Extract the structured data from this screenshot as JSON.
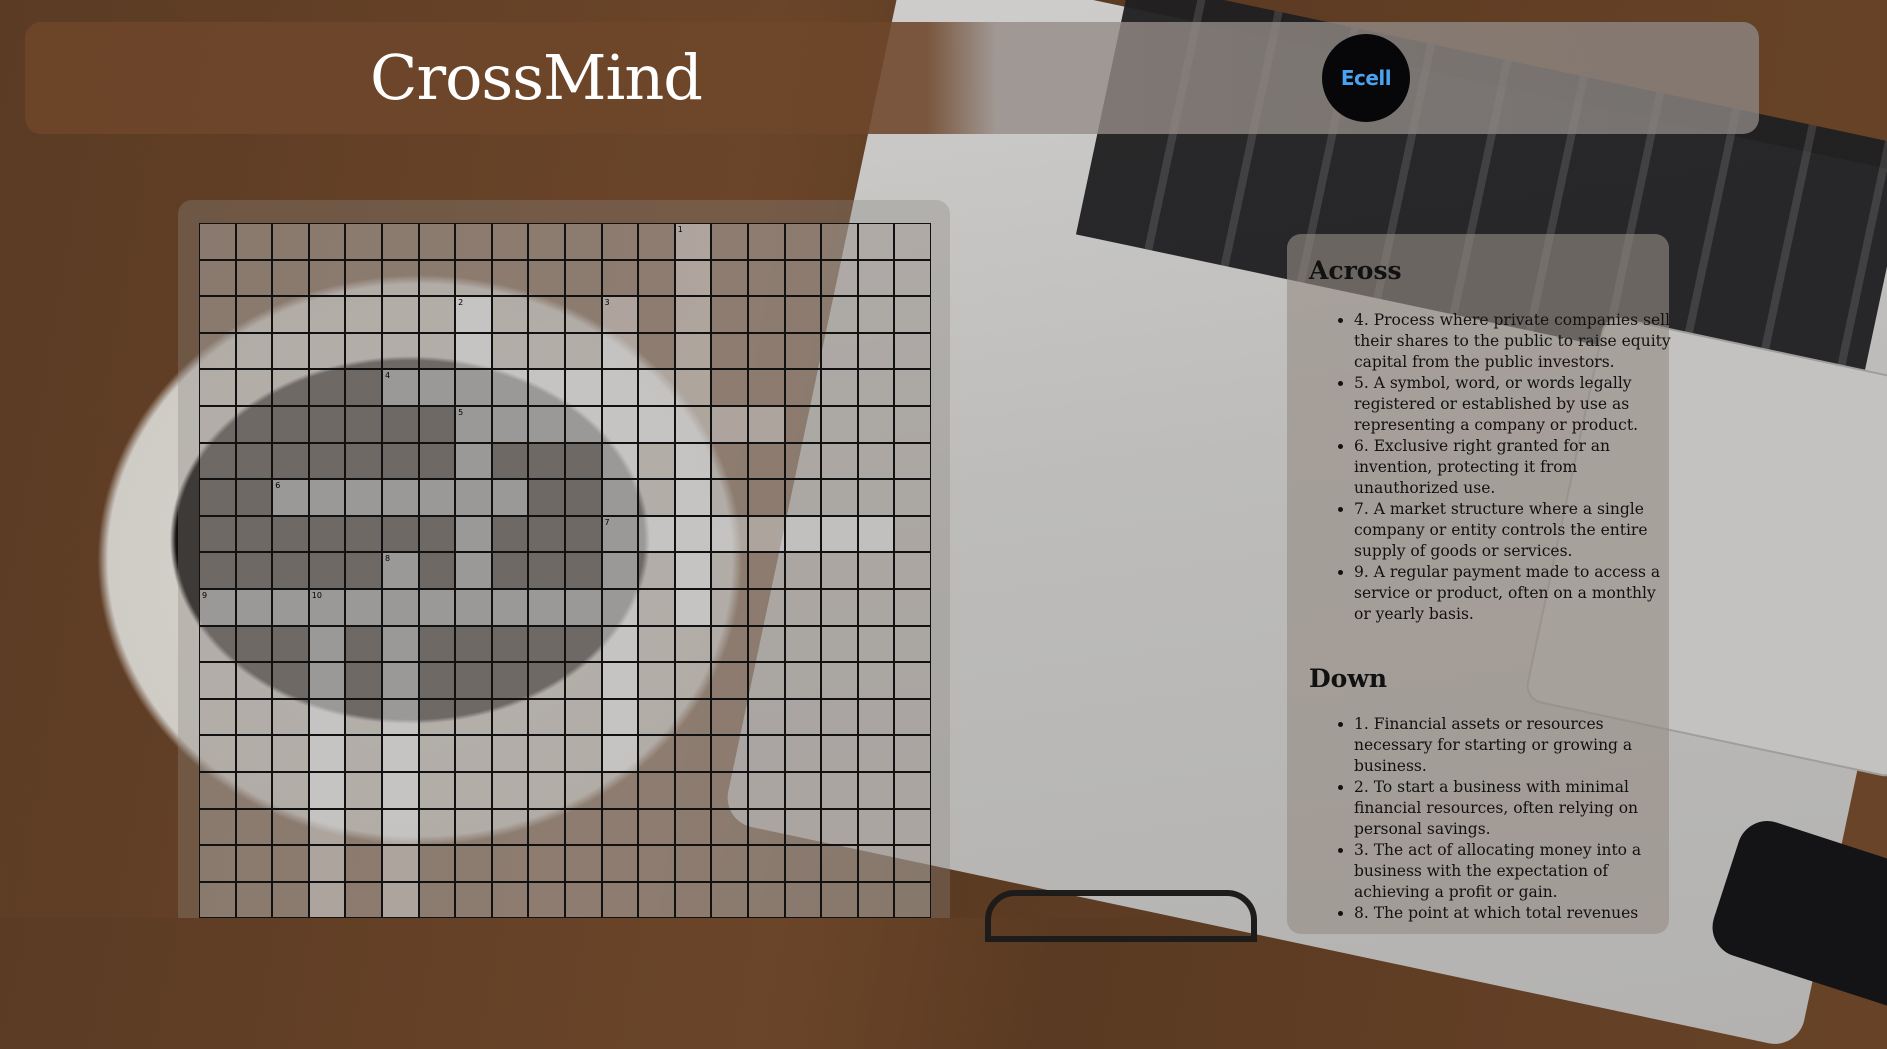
{
  "header": {
    "title": "CrossMind",
    "logo_text": "Ecell"
  },
  "grid": {
    "size": 20,
    "numbers": [
      {
        "n": "1",
        "r": 0,
        "c": 13
      },
      {
        "n": "2",
        "r": 2,
        "c": 7
      },
      {
        "n": "3",
        "r": 2,
        "c": 11
      },
      {
        "n": "4",
        "r": 4,
        "c": 5
      },
      {
        "n": "5",
        "r": 5,
        "c": 7
      },
      {
        "n": "6",
        "r": 7,
        "c": 2
      },
      {
        "n": "7",
        "r": 8,
        "c": 11
      },
      {
        "n": "8",
        "r": 9,
        "c": 5
      },
      {
        "n": "9",
        "r": 10,
        "c": 0
      },
      {
        "n": "10",
        "r": 10,
        "c": 3
      }
    ],
    "light_cells": [
      [
        0,
        13
      ],
      [
        1,
        13
      ],
      [
        2,
        13
      ],
      [
        3,
        13
      ],
      [
        4,
        13
      ],
      [
        5,
        13
      ],
      [
        6,
        13
      ],
      [
        7,
        13
      ],
      [
        8,
        13
      ],
      [
        9,
        13
      ],
      [
        10,
        13
      ],
      [
        2,
        7
      ],
      [
        3,
        7
      ],
      [
        4,
        7
      ],
      [
        5,
        7
      ],
      [
        6,
        7
      ],
      [
        7,
        7
      ],
      [
        8,
        7
      ],
      [
        9,
        7
      ],
      [
        10,
        7
      ],
      [
        2,
        11
      ],
      [
        3,
        11
      ],
      [
        4,
        11
      ],
      [
        5,
        11
      ],
      [
        6,
        11
      ],
      [
        7,
        11
      ],
      [
        8,
        11
      ],
      [
        9,
        11
      ],
      [
        10,
        11
      ],
      [
        11,
        11
      ],
      [
        12,
        11
      ],
      [
        13,
        11
      ],
      [
        14,
        11
      ],
      [
        4,
        5
      ],
      [
        4,
        6
      ],
      [
        4,
        7
      ],
      [
        4,
        8
      ],
      [
        4,
        9
      ],
      [
        4,
        10
      ],
      [
        4,
        11
      ],
      [
        4,
        12
      ],
      [
        5,
        7
      ],
      [
        5,
        8
      ],
      [
        5,
        9
      ],
      [
        5,
        10
      ],
      [
        5,
        11
      ],
      [
        5,
        12
      ],
      [
        5,
        13
      ],
      [
        5,
        14
      ],
      [
        5,
        15
      ],
      [
        7,
        2
      ],
      [
        7,
        3
      ],
      [
        7,
        4
      ],
      [
        7,
        5
      ],
      [
        7,
        6
      ],
      [
        7,
        7
      ],
      [
        7,
        8
      ],
      [
        8,
        11
      ],
      [
        8,
        12
      ],
      [
        8,
        13
      ],
      [
        8,
        14
      ],
      [
        8,
        15
      ],
      [
        8,
        16
      ],
      [
        8,
        17
      ],
      [
        8,
        18
      ],
      [
        9,
        5
      ],
      [
        10,
        5
      ],
      [
        11,
        5
      ],
      [
        12,
        5
      ],
      [
        13,
        5
      ],
      [
        14,
        5
      ],
      [
        15,
        5
      ],
      [
        16,
        5
      ],
      [
        17,
        5
      ],
      [
        18,
        5
      ],
      [
        10,
        0
      ],
      [
        10,
        1
      ],
      [
        10,
        2
      ],
      [
        10,
        3
      ],
      [
        10,
        4
      ],
      [
        10,
        5
      ],
      [
        10,
        6
      ],
      [
        10,
        7
      ],
      [
        10,
        8
      ],
      [
        10,
        9
      ],
      [
        10,
        10
      ],
      [
        10,
        11
      ],
      [
        10,
        3
      ],
      [
        11,
        3
      ],
      [
        12,
        3
      ],
      [
        13,
        3
      ],
      [
        14,
        3
      ],
      [
        15,
        3
      ],
      [
        16,
        3
      ],
      [
        17,
        3
      ],
      [
        18,
        3
      ],
      [
        19,
        3
      ]
    ]
  },
  "clues": {
    "across_title": "Across",
    "across": [
      "4. Process where private companies sell their shares to the public to raise equity capital from the public investors.",
      "5. A symbol, word, or words legally registered or established by use as representing a company or product.",
      "6. Exclusive right granted for an invention, protecting it from unauthorized use.",
      "7. A market structure where a single company or entity controls the entire supply of goods or services.",
      "9. A regular payment made to access a service or product, often on a monthly or yearly basis."
    ],
    "down_title": "Down",
    "down": [
      "1. Financial assets or resources necessary for starting or growing a business.",
      "2. To start a business with minimal financial resources, often relying on personal savings.",
      "3. The act of allocating money into a business with the expectation of achieving a profit or gain.",
      "8. The point at which total revenues"
    ]
  }
}
